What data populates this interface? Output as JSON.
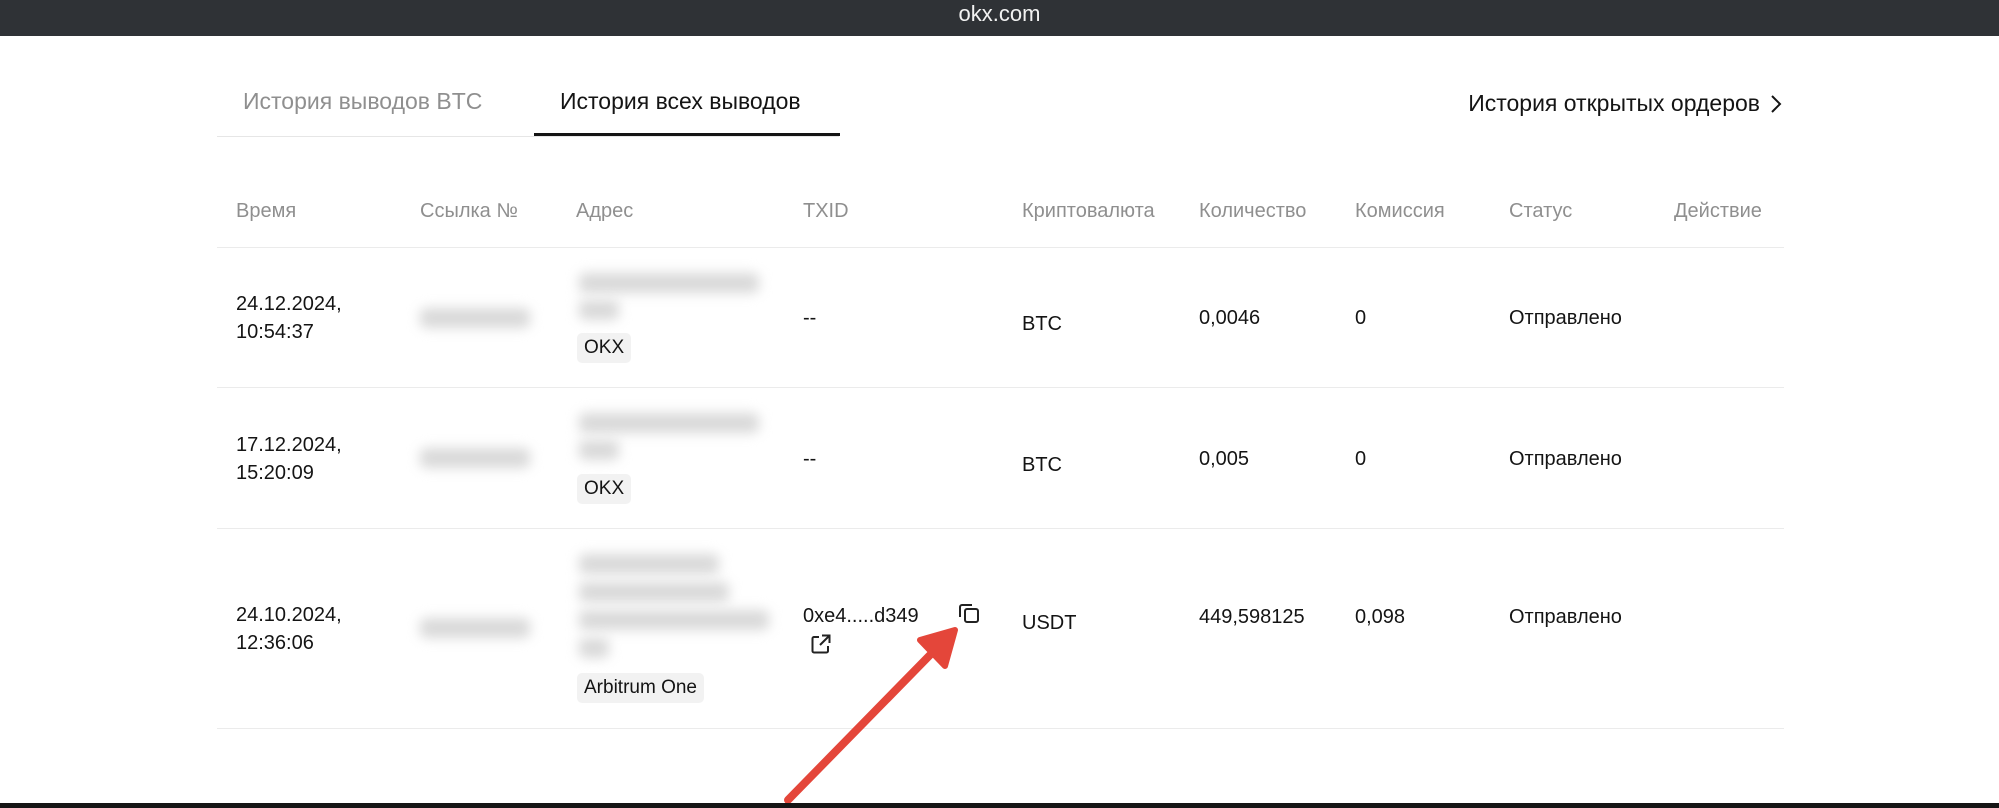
{
  "browser": {
    "url": "okx.com"
  },
  "tabs": {
    "btc_history": "История выводов BTC",
    "all_history": "История всех выводов",
    "open_orders": "История открытых ордеров"
  },
  "table": {
    "headers": {
      "time": "Время",
      "ref": "Ссылка №",
      "address": "Адрес",
      "txid": "TXID",
      "crypto": "Криптовалюта",
      "qty": "Количество",
      "fee": "Комиссия",
      "status": "Статус",
      "action": "Действие"
    },
    "rows": [
      {
        "date": "24.12.2024,",
        "time": "10:54:37",
        "network": "OKX",
        "txid": "--",
        "crypto": "BTC",
        "qty": "0,0046",
        "fee": "0",
        "status": "Отправлено"
      },
      {
        "date": "17.12.2024,",
        "time": "15:20:09",
        "network": "OKX",
        "txid": "--",
        "crypto": "BTC",
        "qty": "0,005",
        "fee": "0",
        "status": "Отправлено"
      },
      {
        "date": "24.10.2024,",
        "time": "12:36:06",
        "network": "Arbitrum One",
        "txid": "0xe4.....d349",
        "crypto": "USDT",
        "qty": "449,598125",
        "fee": "0,098",
        "status": "Отправлено"
      }
    ]
  },
  "icons": {
    "copy": "copy-icon",
    "external": "external-link-icon",
    "chevron": "chevron-right-icon",
    "annotation": "red-arrow"
  },
  "colors": {
    "annotation": "#e4463a",
    "muted": "#8f8f8f"
  }
}
